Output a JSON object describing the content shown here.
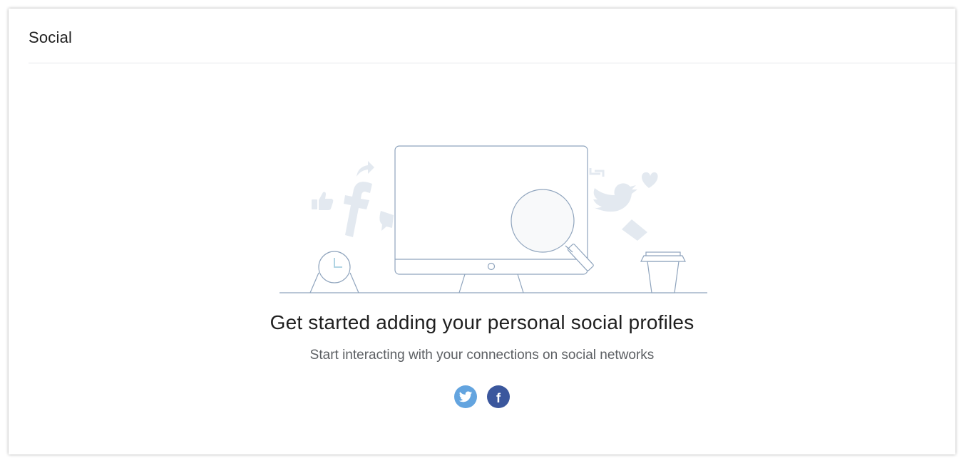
{
  "header": {
    "title": "Social"
  },
  "empty_state": {
    "headline": "Get started adding your personal social profiles",
    "subtext": "Start interacting with your connections on social networks",
    "illustration_icons": [
      "monitor-icon",
      "magnifier-icon",
      "clock-icon",
      "coffee-cup-icon",
      "facebook-icon",
      "twitter-bird-icon",
      "like-icon",
      "share-icon",
      "heart-icon",
      "retweet-icon",
      "envelope-icon"
    ]
  },
  "social_buttons": [
    {
      "name": "twitter-icon",
      "color": "#63a4df"
    },
    {
      "name": "facebook-icon",
      "color": "#3b579d",
      "glyph": "f"
    }
  ],
  "colors": {
    "line": "#8fa4bd",
    "faded_icon": "#e3e9f0",
    "headline": "#1f1f1f",
    "subtext": "#5c5f63"
  }
}
